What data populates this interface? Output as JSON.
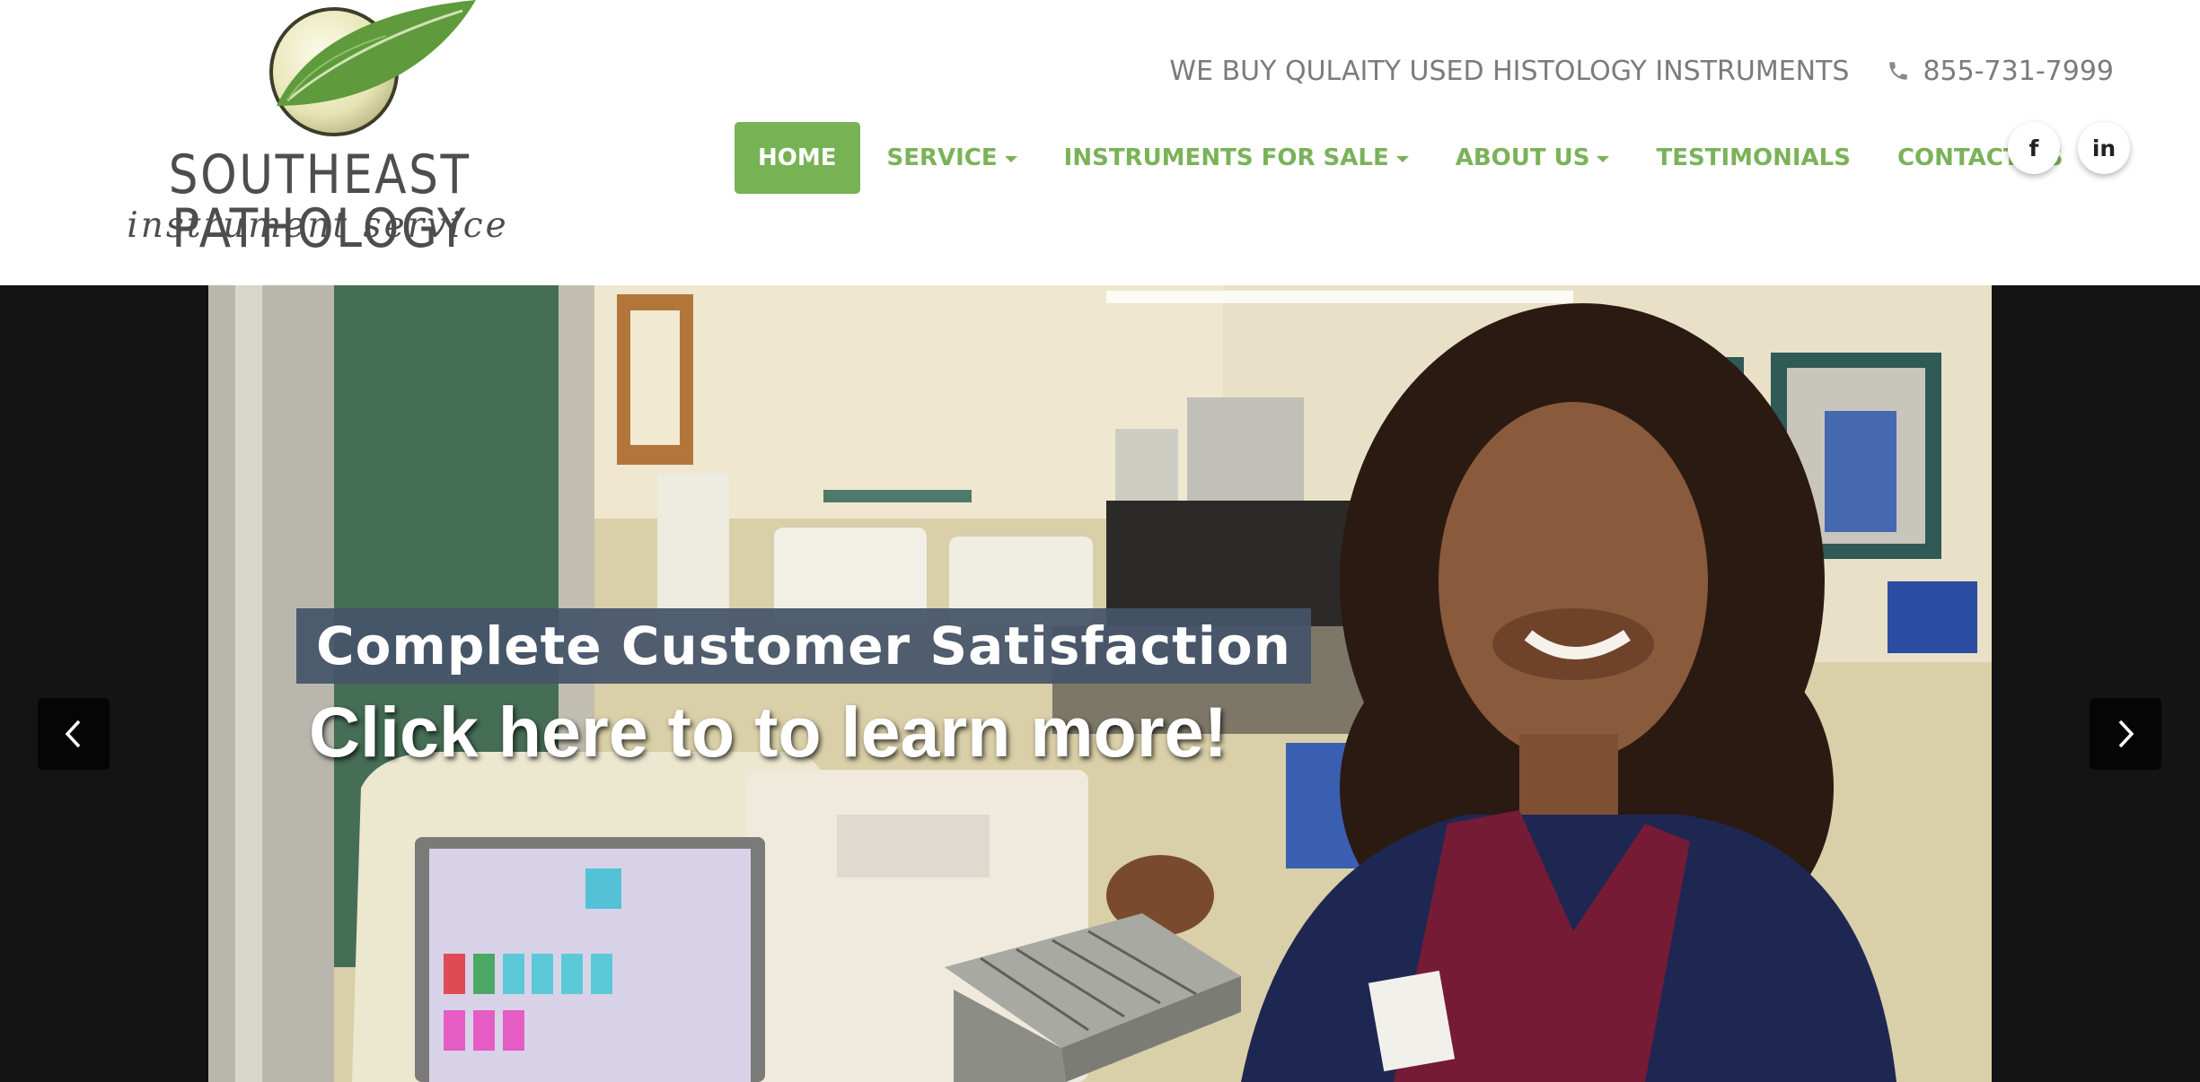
{
  "brand": {
    "name": "SOUTHEAST PATHOLOGY",
    "tagline": "instrument service",
    "colors": {
      "green": "#77b255",
      "nav_text": "#7ab259",
      "caption_bg": "#455469"
    }
  },
  "top_bar": {
    "notice": "WE BUY QULAITY USED HISTOLOGY INSTRUMENTS",
    "phone_icon": "phone-icon",
    "phone": "855-731-7999"
  },
  "nav": {
    "items": [
      {
        "label": "HOME",
        "active": true
      },
      {
        "label": "SERVICE",
        "dropdown": true
      },
      {
        "label": "INSTRUMENTS FOR SALE",
        "dropdown": true
      },
      {
        "label": "ABOUT US",
        "dropdown": true
      },
      {
        "label": "TESTIMONIALS"
      },
      {
        "label": "CONTACT US"
      }
    ]
  },
  "social": {
    "facebook": {
      "icon": "facebook-icon",
      "glyph": "f"
    },
    "linkedin": {
      "icon": "linkedin-icon",
      "glyph": "in"
    }
  },
  "carousel": {
    "caption_title": "Complete Customer Satisfaction",
    "caption_link": "Click here to to learn more!",
    "prev_icon": "chevron-left-icon",
    "next_icon": "chevron-right-icon"
  }
}
